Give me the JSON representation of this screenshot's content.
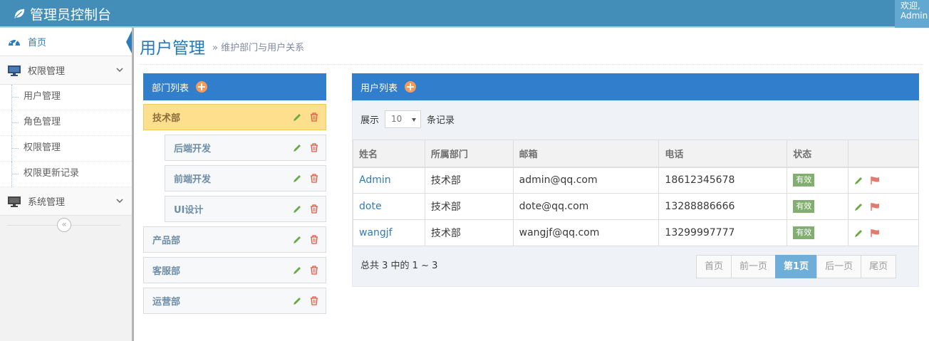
{
  "navbar": {
    "brand": "管理员控制台",
    "welcome": "欢迎,\nAdmin"
  },
  "sidebar": {
    "items": [
      {
        "label": "首页",
        "icon": "dashboard-icon",
        "active": true
      },
      {
        "label": "权限管理",
        "icon": "desktop-icon"
      },
      {
        "label": "系统管理",
        "icon": "desktop-icon"
      }
    ],
    "subitems": [
      "用户管理",
      "角色管理",
      "权限管理",
      "权限更新记录"
    ],
    "collapse_glyph": "«"
  },
  "header": {
    "title": "用户管理",
    "subtitle": "» 维护部门与用户关系"
  },
  "departments": {
    "title": "部门列表",
    "items": [
      {
        "label": "技术部",
        "selected": true
      },
      {
        "label": "后端开发"
      },
      {
        "label": "前端开发"
      },
      {
        "label": "UI设计"
      },
      {
        "label": "产品部"
      },
      {
        "label": "客服部"
      },
      {
        "label": "运营部"
      }
    ]
  },
  "users": {
    "title": "用户列表",
    "length_prefix": "展示",
    "length_value": "10",
    "length_suffix": "条记录",
    "columns": [
      "姓名",
      "所属部门",
      "邮箱",
      "电话",
      "状态",
      ""
    ],
    "rows": [
      {
        "name": "Admin",
        "dept": "技术部",
        "email": "admin@qq.com",
        "phone": "18612345678",
        "status": "有效"
      },
      {
        "name": "dote",
        "dept": "技术部",
        "email": "dote@qq.com",
        "phone": "13288886666",
        "status": "有效"
      },
      {
        "name": "wangjf",
        "dept": "技术部",
        "email": "wangjf@qq.com",
        "phone": "13299997777",
        "status": "有效"
      }
    ],
    "summary": "总共 3 中的 1 ~ 3",
    "pager": [
      "首页",
      "前一页",
      "第1页",
      "后一页",
      "尾页"
    ],
    "current_page": "第1页"
  },
  "colors": {
    "navbar": "#438eb9",
    "panel_head": "#307ecc",
    "selected_dept": "#fddf8e",
    "badge": "#82af6f",
    "edit": "#69aa46",
    "delete": "#dd5a43",
    "flag": "#e07b6d"
  }
}
